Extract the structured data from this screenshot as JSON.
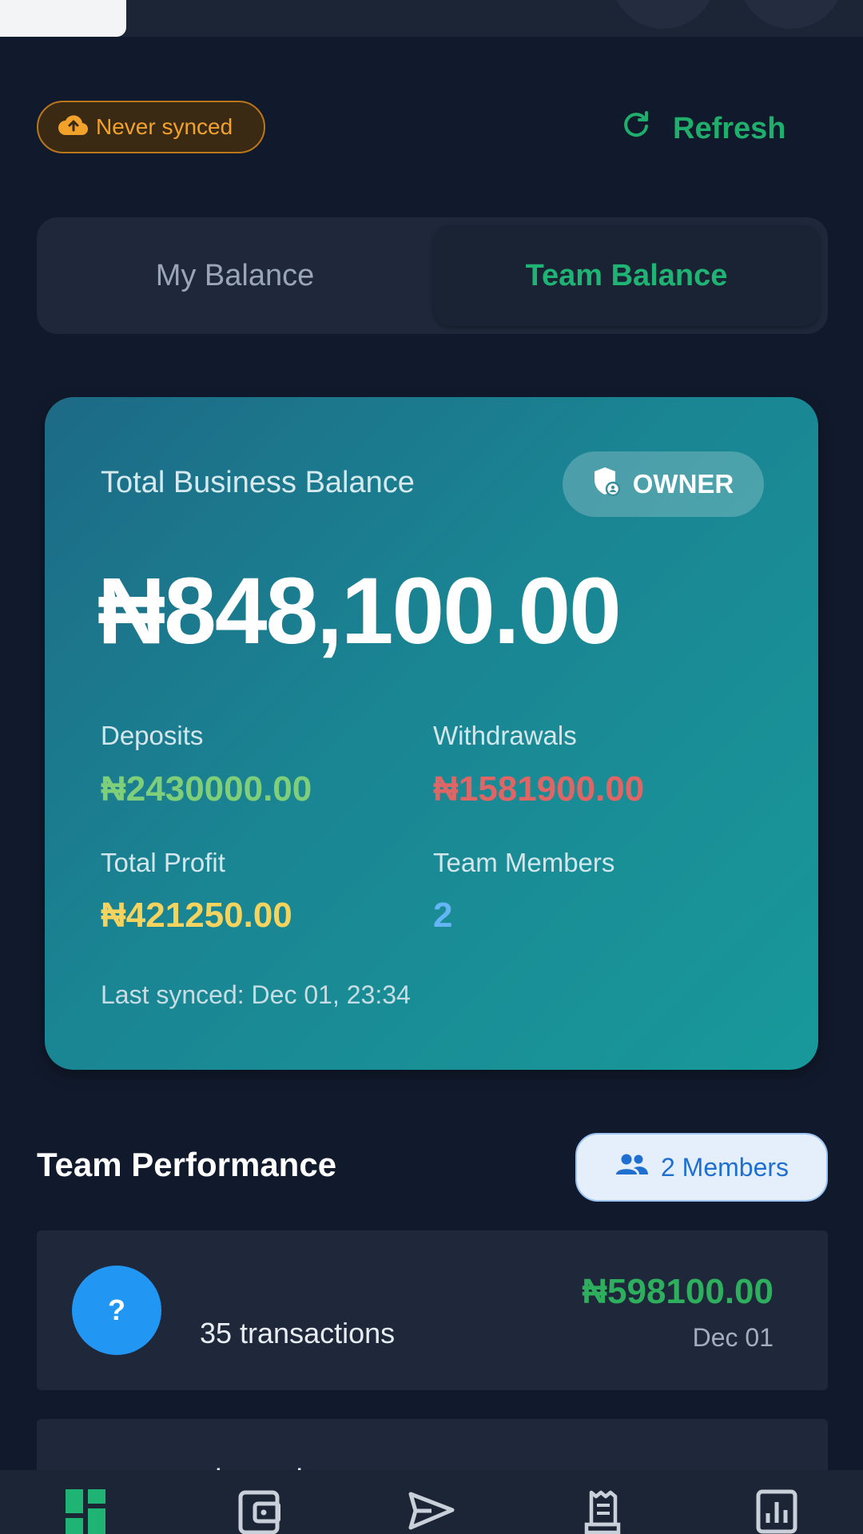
{
  "sync": {
    "status_label": "Never synced",
    "refresh_label": "Refresh"
  },
  "tabs": [
    {
      "label": "My Balance",
      "active": false
    },
    {
      "label": "Team Balance",
      "active": true
    }
  ],
  "card": {
    "title": "Total Business Balance",
    "role_badge": "OWNER",
    "balance": "₦848,100.00",
    "stats": {
      "deposits_label": "Deposits",
      "deposits_value": "₦2430000.00",
      "withdrawals_label": "Withdrawals",
      "withdrawals_value": "₦1581900.00",
      "profit_label": "Total Profit",
      "profit_value": "₦421250.00",
      "members_label": "Team Members",
      "members_value": "2"
    },
    "last_synced": "Last synced: Dec 01, 23:34"
  },
  "team": {
    "section_title": "Team Performance",
    "members_badge": "2 Members",
    "rows": [
      {
        "avatar": "?",
        "transactions": "35 transactions",
        "amount": "₦598100.00",
        "date": "Dec 01"
      },
      {
        "name": "olayemi"
      }
    ]
  },
  "colors": {
    "accent_green": "#1fb374",
    "deposit": "#7fcf7a",
    "withdrawal": "#e06666",
    "profit": "#f4d35e",
    "members": "#64b5f6",
    "sync_warning": "#f2a22a"
  },
  "nav": [
    "dashboard-icon",
    "wallet-icon",
    "send-icon",
    "receipt-icon",
    "chart-icon"
  ]
}
